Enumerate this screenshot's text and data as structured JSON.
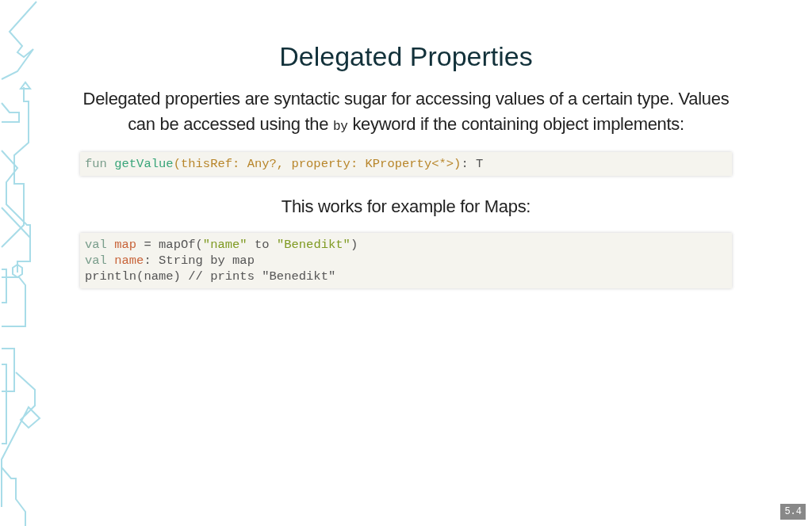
{
  "slide": {
    "title": "Delegated Properties",
    "intro": [
      {
        "kind": "text",
        "text": "Delegated properties are syntactic sugar for accessing values of a certain type. Values can be accessed using the "
      },
      {
        "kind": "code",
        "text": "by"
      },
      {
        "kind": "text",
        "text": " keyword if the containing object implements:"
      }
    ],
    "code_1": [
      [
        {
          "kind": "keyword",
          "text": "fun "
        },
        {
          "kind": "function",
          "text": "getValue"
        },
        {
          "kind": "param",
          "text": "(thisRef: Any?, property: KProperty<*>)"
        },
        {
          "kind": "plain",
          "text": ": T"
        }
      ]
    ],
    "caption": "This works for example for Maps:",
    "code_2": [
      [
        {
          "kind": "keyword",
          "text": "val "
        },
        {
          "kind": "variable",
          "text": "map"
        },
        {
          "kind": "plain",
          "text": " = mapOf("
        },
        {
          "kind": "string",
          "text": "\"name\""
        },
        {
          "kind": "plain",
          "text": " to "
        },
        {
          "kind": "string",
          "text": "\"Benedikt\""
        },
        {
          "kind": "plain",
          "text": ")"
        }
      ],
      [
        {
          "kind": "keyword",
          "text": "val "
        },
        {
          "kind": "variable",
          "text": "name"
        },
        {
          "kind": "plain",
          "text": ": String by map"
        }
      ],
      [
        {
          "kind": "plain",
          "text": "println(name) // prints \"Benedikt\""
        }
      ]
    ],
    "slide_number": "5.4"
  }
}
